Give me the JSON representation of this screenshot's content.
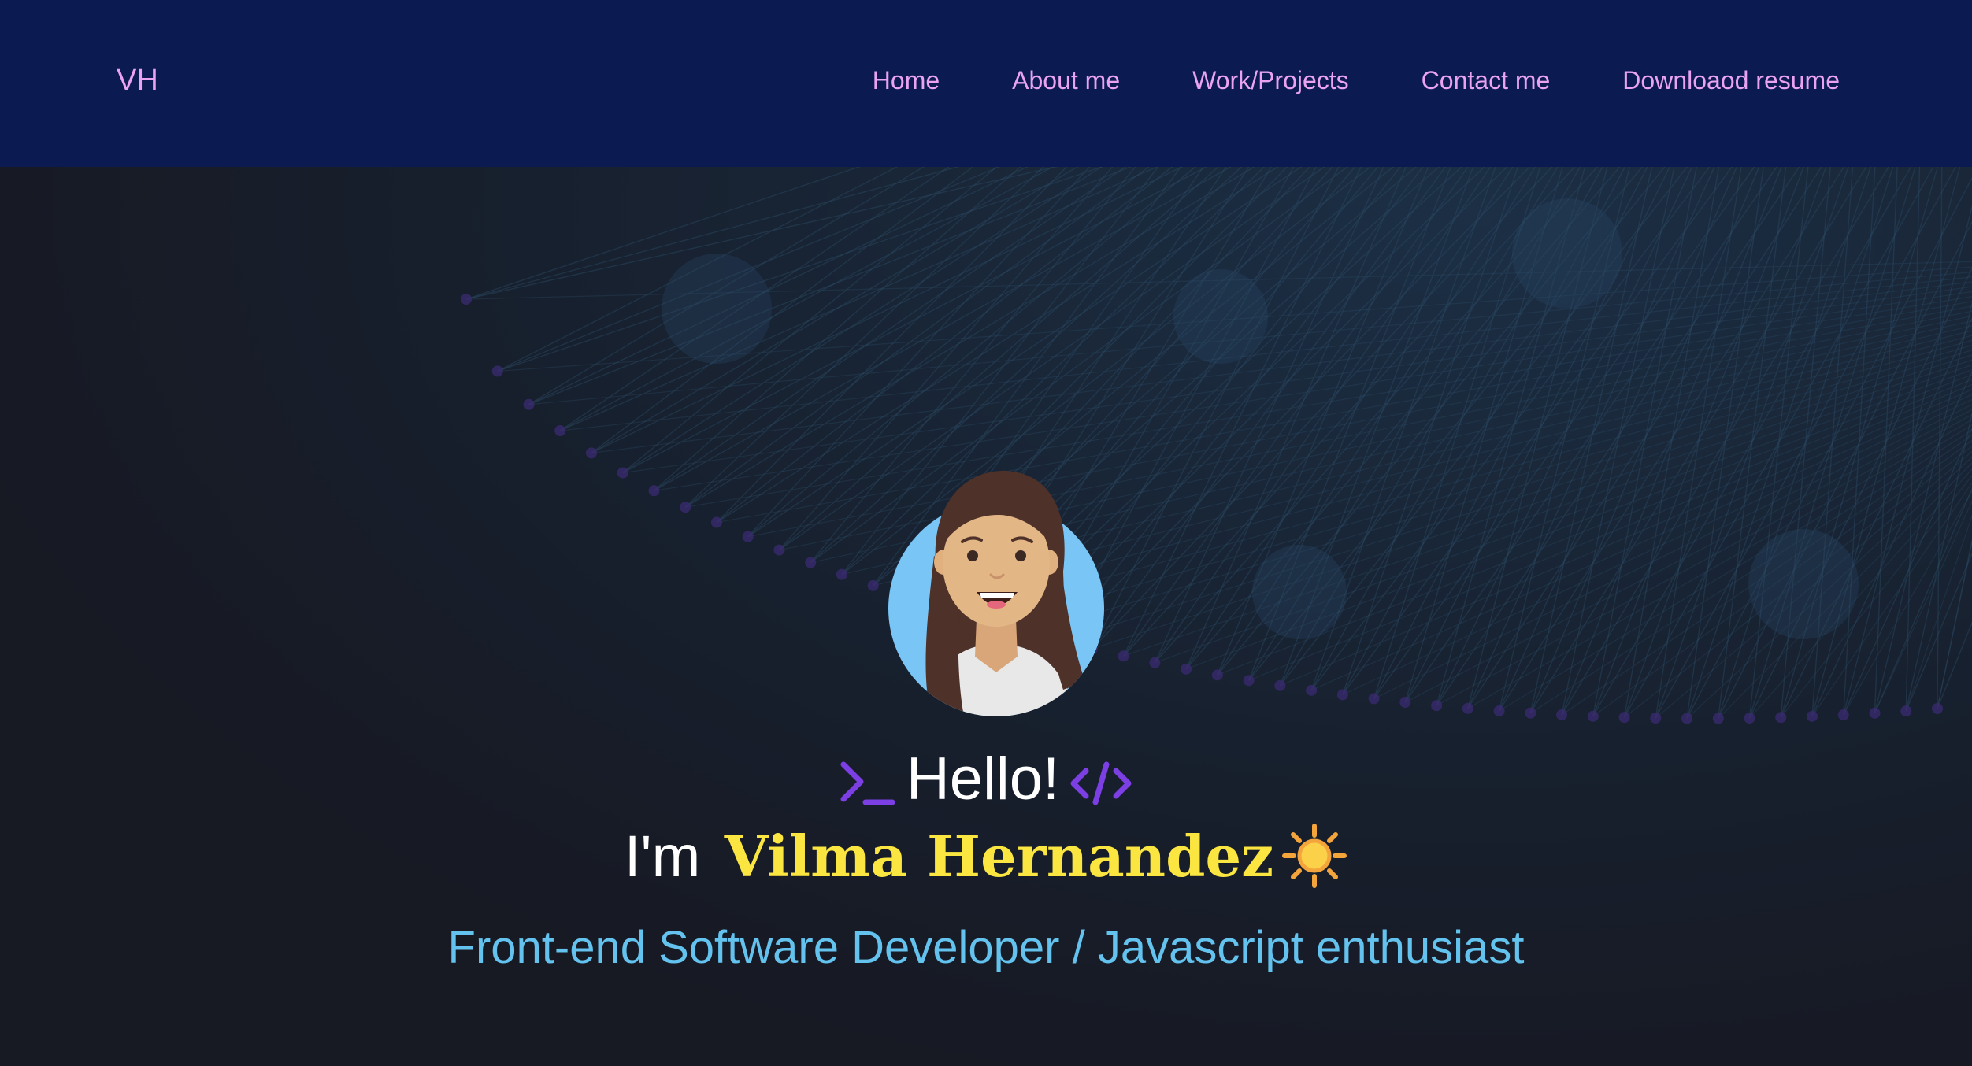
{
  "navbar": {
    "brand": "VH",
    "links": [
      {
        "label": "Home"
      },
      {
        "label": "About me"
      },
      {
        "label": "Work/Projects"
      },
      {
        "label": "Contact me"
      },
      {
        "label": "Downloaod resume"
      }
    ]
  },
  "hero": {
    "greeting": "Hello!",
    "intro": "I'm",
    "name": "Vilma Hernandez",
    "subtitle": "Front-end Software Developer / Javascript enthusiast",
    "icons": {
      "prompt": "terminal-prompt-icon",
      "code": "code-tag-icon",
      "sun": "sun-emoji-icon",
      "avatar": "avatar-illustration"
    }
  },
  "colors": {
    "navbar_bg": "#0c1a52",
    "nav_link": "#e9a3f1",
    "page_bg": "#171923",
    "name": "#fbe540",
    "subtitle": "#63c3ee",
    "icon_purple": "#7b3fe4"
  }
}
